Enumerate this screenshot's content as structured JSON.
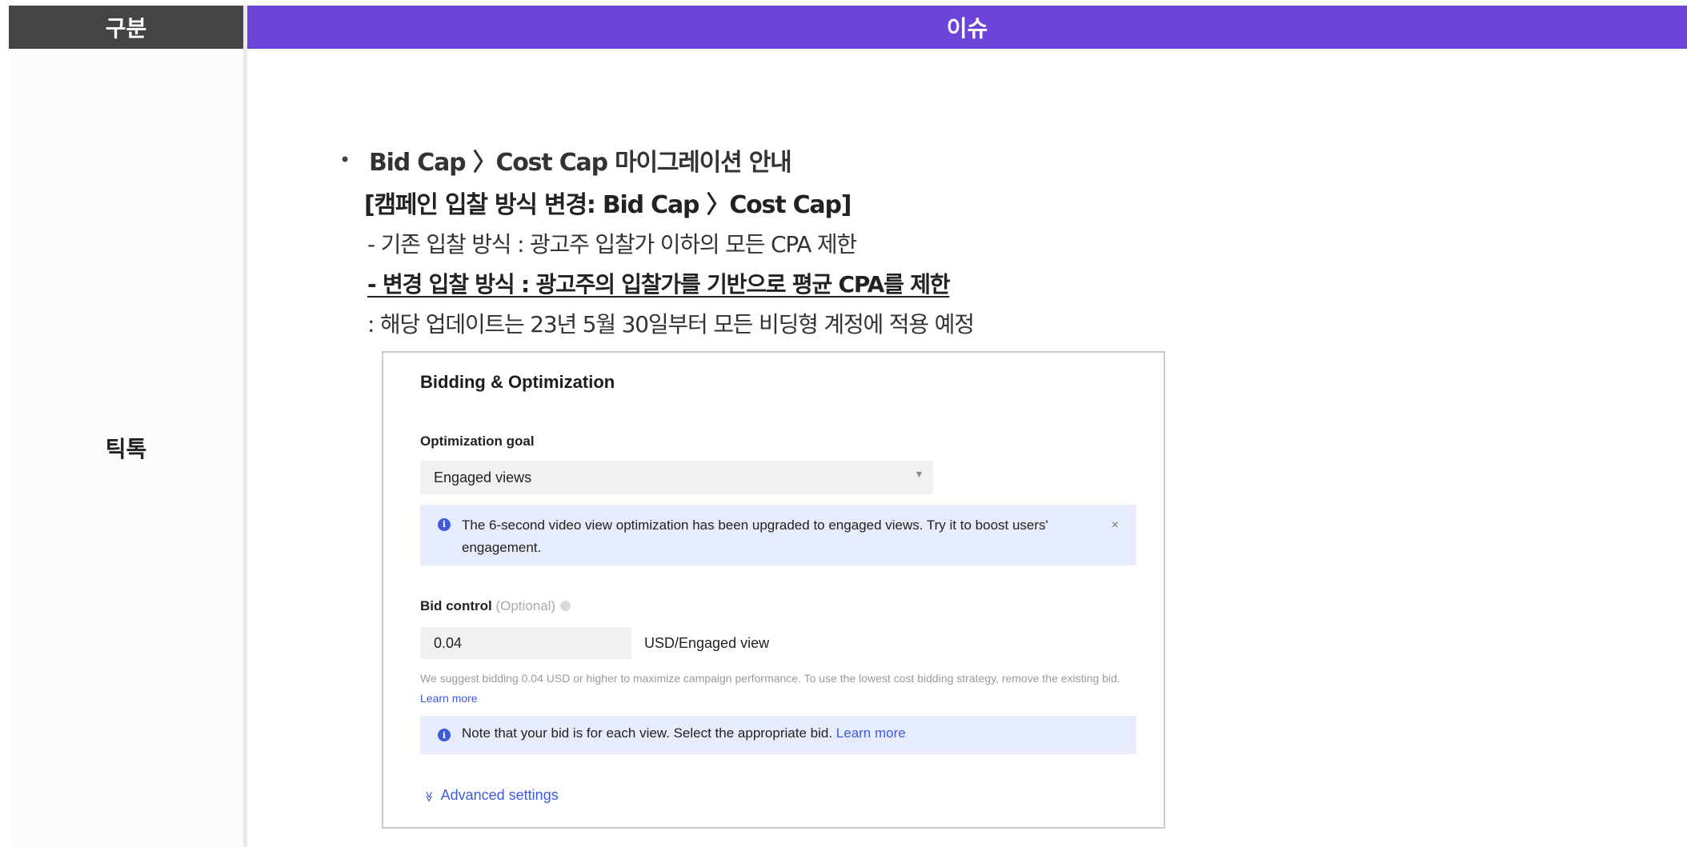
{
  "table": {
    "header_category": "구분",
    "header_issue": "이슈",
    "row_label": "틱톡"
  },
  "issue": {
    "bullet": "•",
    "title": "Bid Cap 〉Cost Cap 마이그레이션 안내",
    "subtitle": "[캠페인 입찰 방식 변경: Bid Cap 〉Cost Cap]",
    "line_existing": "- 기존 입찰 방식 : 광고주 입찰가 이하의 모든 CPA 제한",
    "line_changed": "- 변경 입찰 방식 : 광고주의 입찰가를 기반으로 평균 CPA를 제한",
    "line_note": ": 해당 업데이트는 23년 5월 30일부터 모든 비딩형 계정에 적용 예정"
  },
  "screenshot": {
    "title": "Bidding & Optimization",
    "optimization_goal_label": "Optimization goal",
    "optimization_goal_value": "Engaged views",
    "info_upgrade": "The 6-second video view optimization has been upgraded to engaged views. Try it to boost users' engagement.",
    "close_symbol": "×",
    "bid_control_label": "Bid control",
    "bid_control_optional": "(Optional)",
    "bid_value": "0.04",
    "bid_unit": "USD/Engaged view",
    "hint_text": "We suggest bidding 0.04 USD or higher to maximize campaign performance. To use the lowest cost bidding strategy, remove the existing bid.",
    "hint_link": "Learn more",
    "info_note": "Note that your bid is for each view. Select the appropriate bid.",
    "info_note_link": "Learn more",
    "advanced_settings": "Advanced settings",
    "info_icon_glyph": "i",
    "advanced_icon_glyph": "≫"
  },
  "colors": {
    "header_dark": "#444444",
    "header_purple": "#6c44d8",
    "info_bg": "#e6ecfb",
    "link_blue": "#3f5bd9"
  }
}
